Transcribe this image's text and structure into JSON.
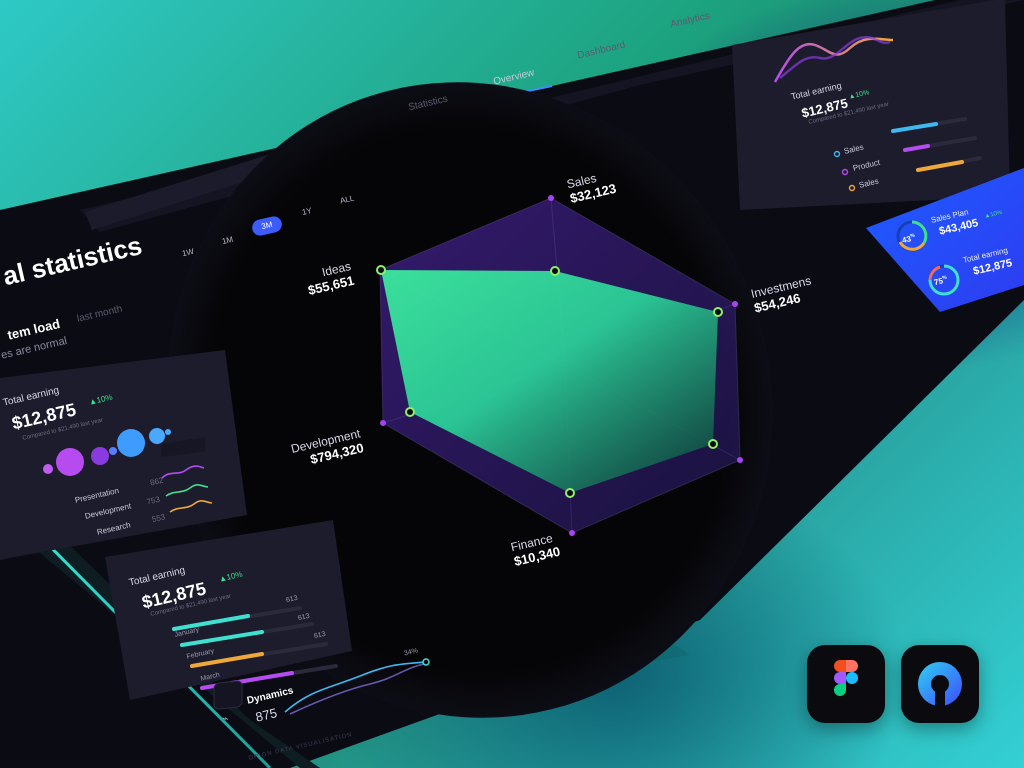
{
  "tabs": [
    "Statistics",
    "Overview",
    "Dashboard",
    "Analytics"
  ],
  "active_tab": "Overview",
  "page": {
    "title": "al statistics",
    "subtitle": "tem load",
    "period_label": "last month",
    "status_text": "es are normal"
  },
  "time_filters": [
    "1W",
    "1M",
    "3M",
    "1Y",
    "ALL"
  ],
  "active_filter": "3M",
  "radar": {
    "labels": [
      {
        "name": "Sales",
        "value": "$32,123"
      },
      {
        "name": "Investmens",
        "value": "$54,246"
      },
      {
        "name": "Finance",
        "value": "$10,340"
      },
      {
        "name": "Development",
        "value": "$794,320"
      },
      {
        "name": "Ideas",
        "value": "$55,651"
      }
    ]
  },
  "card_left_top": {
    "title": "Total earning",
    "value": "$12,875",
    "change": "10%",
    "compare": "Compared to $21,490 last year",
    "rows": [
      {
        "label": "Presentation",
        "value": "862"
      },
      {
        "label": "Development",
        "value": "753"
      },
      {
        "label": "Research",
        "value": "553"
      }
    ]
  },
  "card_left_bottom": {
    "title": "Total earning",
    "value": "$12,875",
    "change": "10%",
    "compare": "Compared to $21,490 last year",
    "bars": [
      {
        "label": "",
        "value": "613",
        "fill": 0.62,
        "color": "#3fe0d0"
      },
      {
        "label": "January",
        "value": "613",
        "fill": 0.52,
        "color": "#3fe0d0"
      },
      {
        "label": "February",
        "value": "613",
        "fill": 0.55,
        "color": "#f0a73a"
      },
      {
        "label": "March",
        "value": "",
        "fill": 0.7,
        "color": "#b44cf0"
      }
    ]
  },
  "dynamics": {
    "title": "Dynamics",
    "value": "875",
    "percent": "34%"
  },
  "card_right_top": {
    "title": "Total earning",
    "value": "$12,875",
    "change": "10%",
    "compare": "Compared to $21,490 last year",
    "legend": [
      {
        "label": "Sales",
        "color": "#3fb8f0",
        "fill": 0.7
      },
      {
        "label": "Product",
        "color": "#b44cf0",
        "fill": 0.35
      },
      {
        "label": "Sales",
        "color": "#f0a73a",
        "fill": 0.8
      }
    ]
  },
  "card_right_blue": {
    "items": [
      {
        "title": "Sales Plan",
        "value": "$43,405",
        "change": "10%",
        "percent": "43"
      },
      {
        "title": "Total earning",
        "value": "$12,875",
        "change": "",
        "percent": "75"
      }
    ]
  },
  "footer_text": "ORION DATA VISUALISATION",
  "colors": {
    "accent": "#3d5cff",
    "green": "#3fe08c",
    "purple": "#b44cf0",
    "orange": "#f0a73a"
  }
}
